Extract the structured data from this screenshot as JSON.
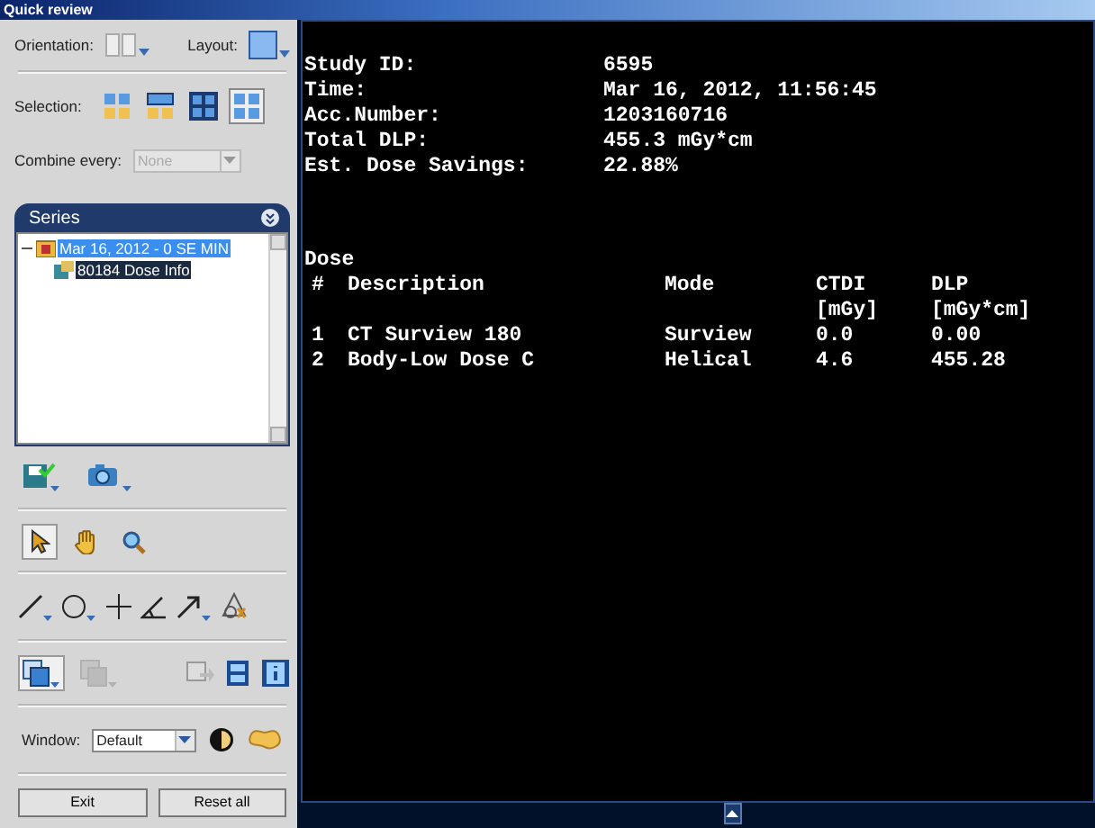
{
  "window": {
    "title": "Quick review"
  },
  "controls": {
    "orientation_label": "Orientation:",
    "layout_label": "Layout:",
    "selection_label": "Selection:",
    "selection_options": [
      {
        "kind": "four",
        "selected": false
      },
      {
        "kind": "rows",
        "selected": false
      },
      {
        "kind": "dark",
        "selected": false
      },
      {
        "kind": "grid",
        "selected": true
      }
    ],
    "combine_label": "Combine every:",
    "combine": {
      "value": "None",
      "disabled": true
    }
  },
  "series": {
    "title": "Series",
    "items": [
      {
        "label": "Mar 16, 2012 - 0 SE MIN",
        "selected": true,
        "expanded": true,
        "children": [
          {
            "label": "80184  Dose Info",
            "selected": true
          }
        ]
      }
    ]
  },
  "tools": [
    {
      "kind": "pointer",
      "selected": true
    },
    {
      "kind": "hand",
      "selected": false
    },
    {
      "kind": "zoom",
      "selected": false
    }
  ],
  "overlay_tools": [
    {
      "kind": "layers",
      "selected": true,
      "disabled": false
    },
    {
      "kind": "layers",
      "selected": false,
      "disabled": true
    }
  ],
  "window_control": {
    "label": "Window:",
    "value": "Default"
  },
  "buttons": [
    "Exit",
    "Reset all"
  ],
  "report": {
    "fields": [
      {
        "label": "Study ID:",
        "value": "6595"
      },
      {
        "label": "Time:",
        "value": "Mar 16, 2012, 11:56:45"
      },
      {
        "label": "Acc.Number:",
        "value": "1203160716"
      },
      {
        "label": "Total DLP:",
        "value": "455.3 mGy*cm"
      },
      {
        "label": "Est. Dose Savings:",
        "value": "22.88%"
      }
    ],
    "section": "Dose",
    "columns": [
      {
        "label": "#"
      },
      {
        "label": "Description"
      },
      {
        "label": "Mode"
      },
      {
        "label": "CTDI",
        "unit": "[mGy]"
      },
      {
        "label": "DLP",
        "unit": "[mGy*cm]"
      }
    ],
    "rows": [
      [
        "1",
        "CT Surview 180",
        "Surview",
        "0.0",
        "0.00"
      ],
      [
        "2",
        "Body-Low Dose C",
        "Helical",
        "4.6",
        "455.28"
      ]
    ]
  }
}
